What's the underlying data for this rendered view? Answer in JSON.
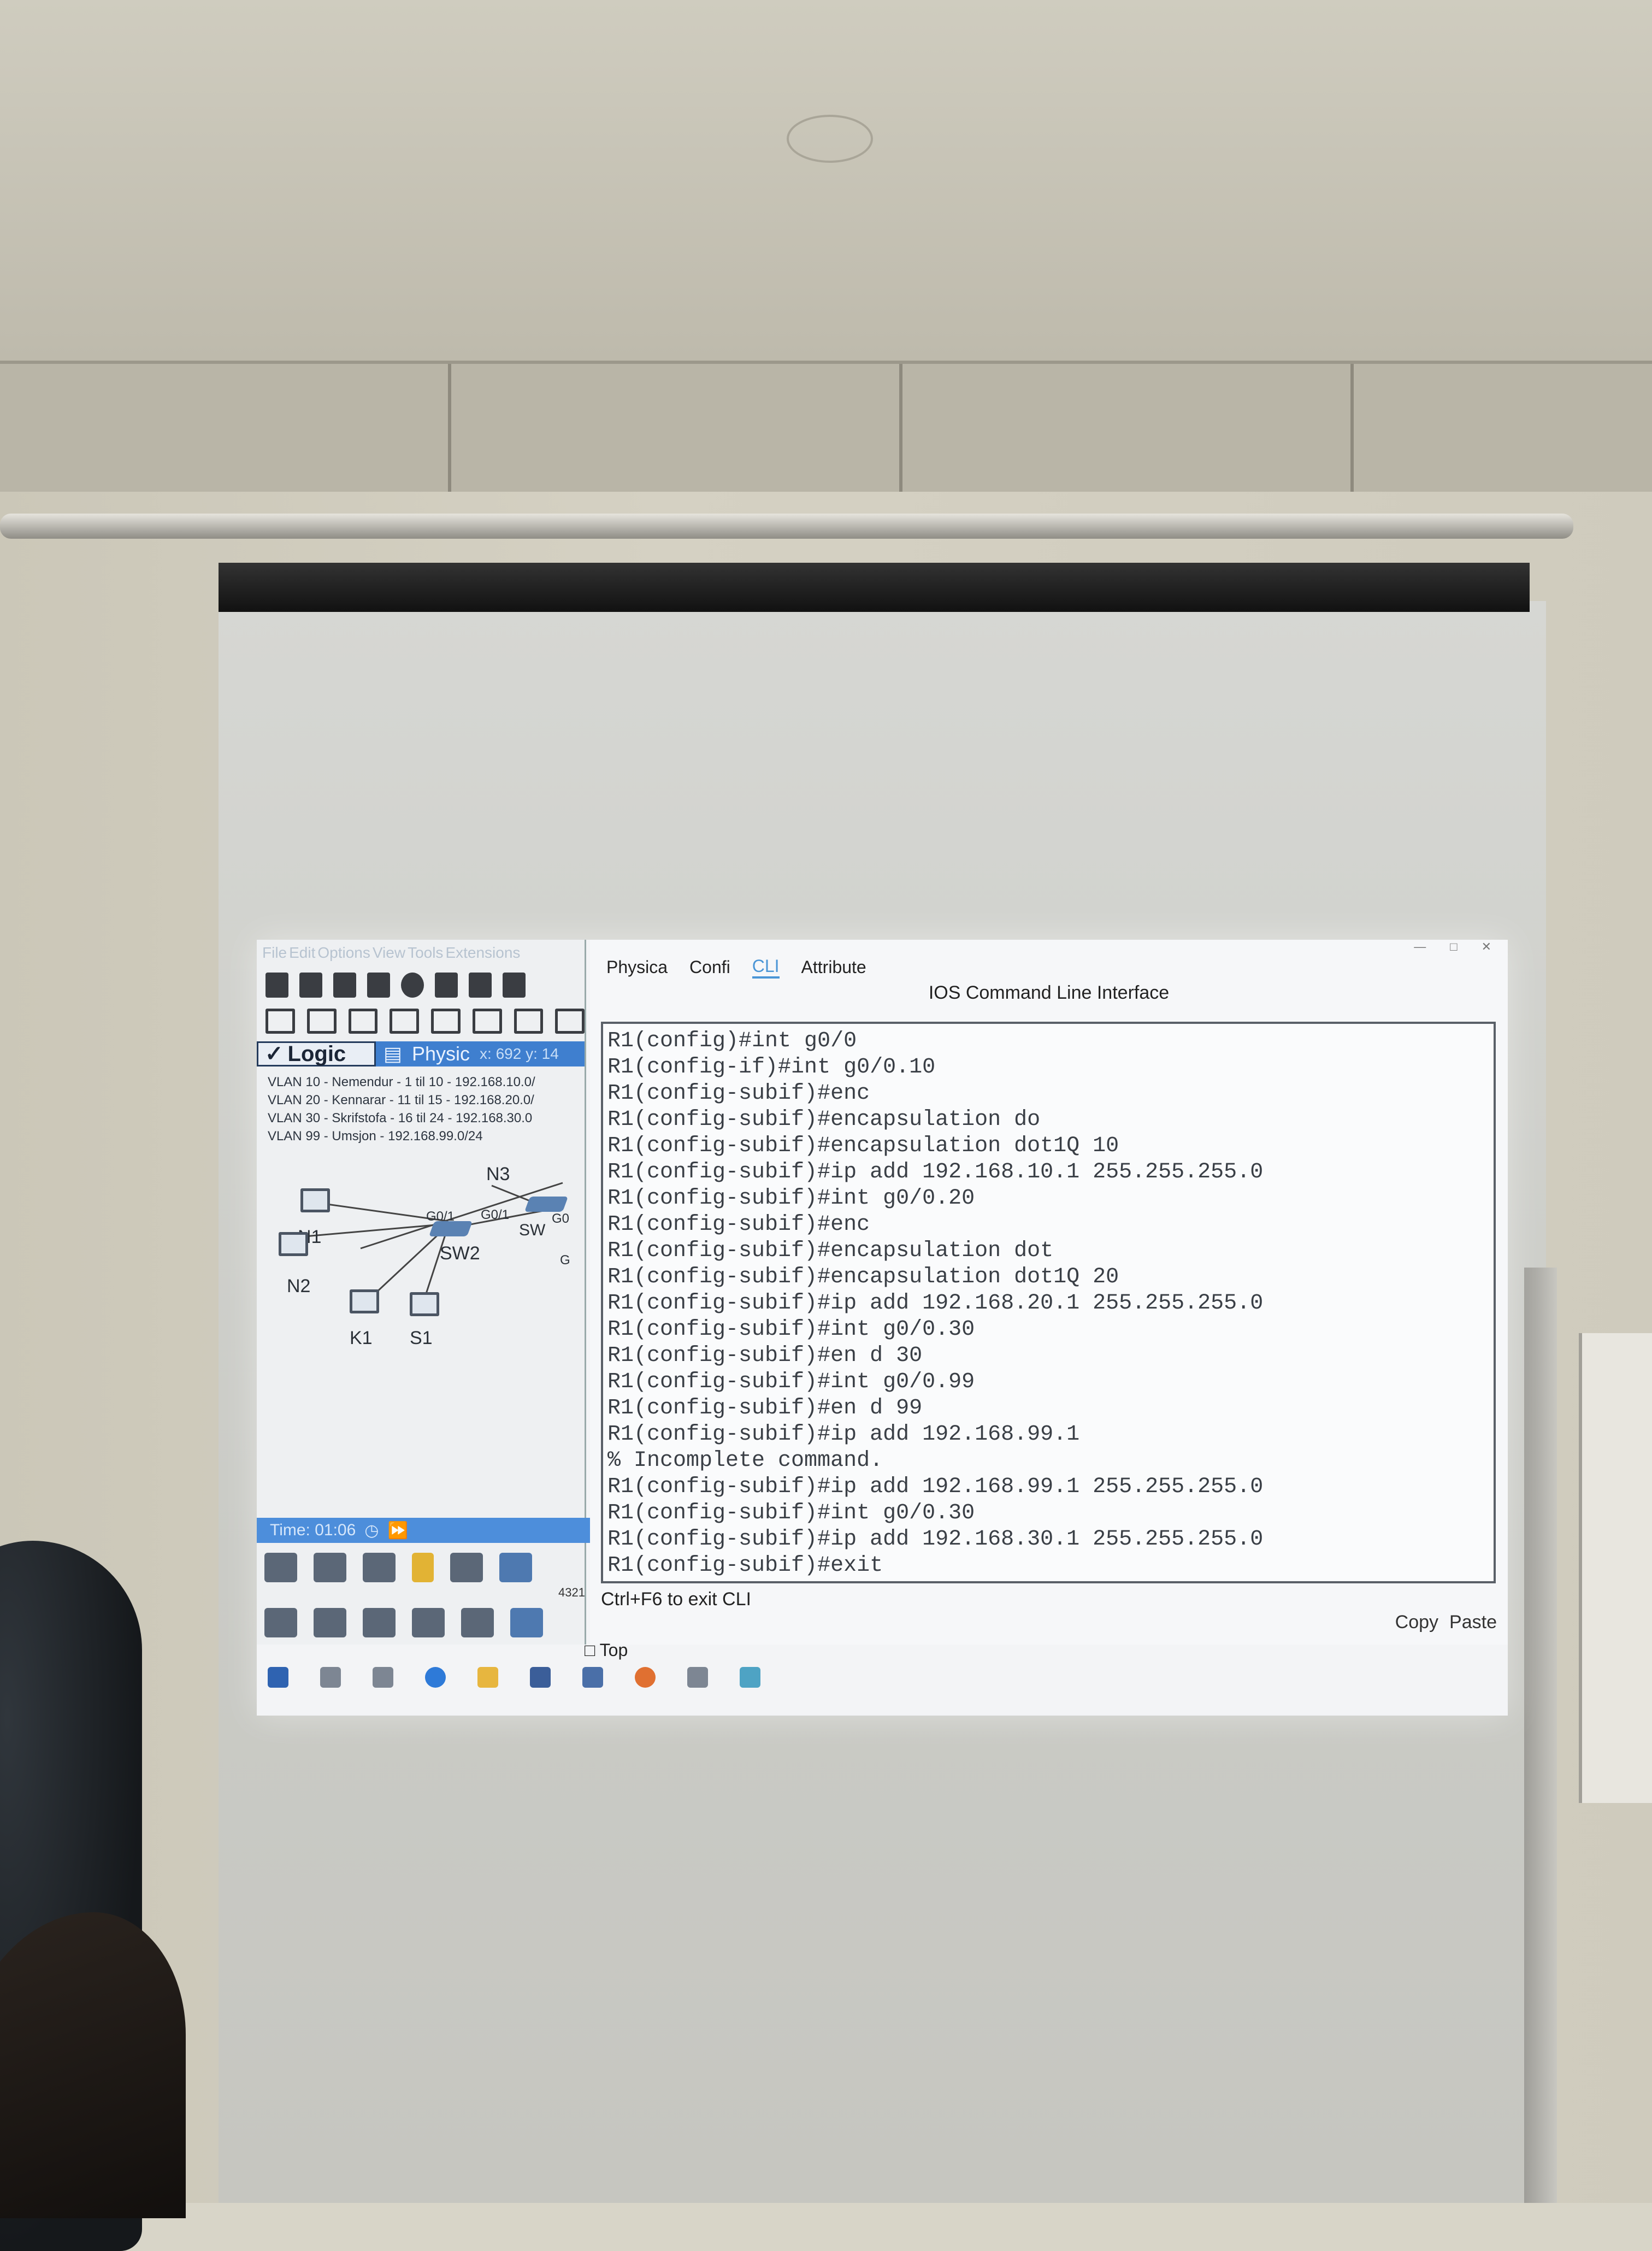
{
  "packet_tracer": {
    "menu": [
      "File",
      "Edit",
      "Options",
      "View",
      "Tools",
      "Extensions"
    ],
    "tab_logical": "Logic",
    "tab_physical": "Physic",
    "coords": "x: 692  y: 14",
    "vlan_notes": [
      "VLAN 10 - Nemendur - 1 til 10 - 192.168.10.0/",
      "VLAN 20 - Kennarar - 11 til 15 - 192.168.20.0/",
      "VLAN 30 - Skrifstofa - 16 til 24 - 192.168.30.0",
      "VLAN 99 - Umsjon - 192.168.99.0/24"
    ],
    "topology": {
      "devices": [
        "N3",
        "SW",
        "N1",
        "N2",
        "SW2",
        "K1",
        "S1"
      ],
      "ports": [
        "G0/1",
        "G0",
        "G0/1",
        "G"
      ]
    },
    "time_label": "Time: 01:06",
    "model_label": "4321"
  },
  "cli": {
    "tabs": [
      "Physica",
      "Confi",
      "CLI",
      "Attribute"
    ],
    "active_tab": "CLI",
    "heading": "IOS Command Line Interface",
    "lines": [
      "R1(config)#int g0/0",
      "R1(config-if)#int g0/0.10",
      "R1(config-subif)#enc",
      "R1(config-subif)#encapsulation do",
      "R1(config-subif)#encapsulation dot1Q 10",
      "R1(config-subif)#ip add 192.168.10.1 255.255.255.0",
      "R1(config-subif)#int g0/0.20",
      "R1(config-subif)#enc",
      "R1(config-subif)#encapsulation dot",
      "R1(config-subif)#encapsulation dot1Q 20",
      "R1(config-subif)#ip add 192.168.20.1 255.255.255.0",
      "R1(config-subif)#int g0/0.30",
      "R1(config-subif)#en d 30",
      "R1(config-subif)#int g0/0.99",
      "R1(config-subif)#en d 99",
      "R1(config-subif)#ip add 192.168.99.1",
      "% Incomplete command.",
      "R1(config-subif)#ip add 192.168.99.1 255.255.255.0",
      "R1(config-subif)#int g0/0.30",
      "R1(config-subif)#ip add 192.168.30.1 255.255.255.0",
      "R1(config-subif)#exit"
    ],
    "exit_hint": "Ctrl+F6 to exit CLI",
    "copy_label": "Copy",
    "paste_label": "Paste",
    "top_label": "Top"
  },
  "taskbar": {
    "icons": [
      "windows-start-icon",
      "search-icon",
      "task-view-icon",
      "edge-icon",
      "file-explorer-icon",
      "store-icon",
      "mail-icon",
      "firefox-icon",
      "app-icon",
      "packet-tracer-icon"
    ]
  },
  "colors": {
    "cli_text": "#3a3f46",
    "accent_blue": "#4a95d6",
    "physical_tab": "#3f7fcf"
  }
}
